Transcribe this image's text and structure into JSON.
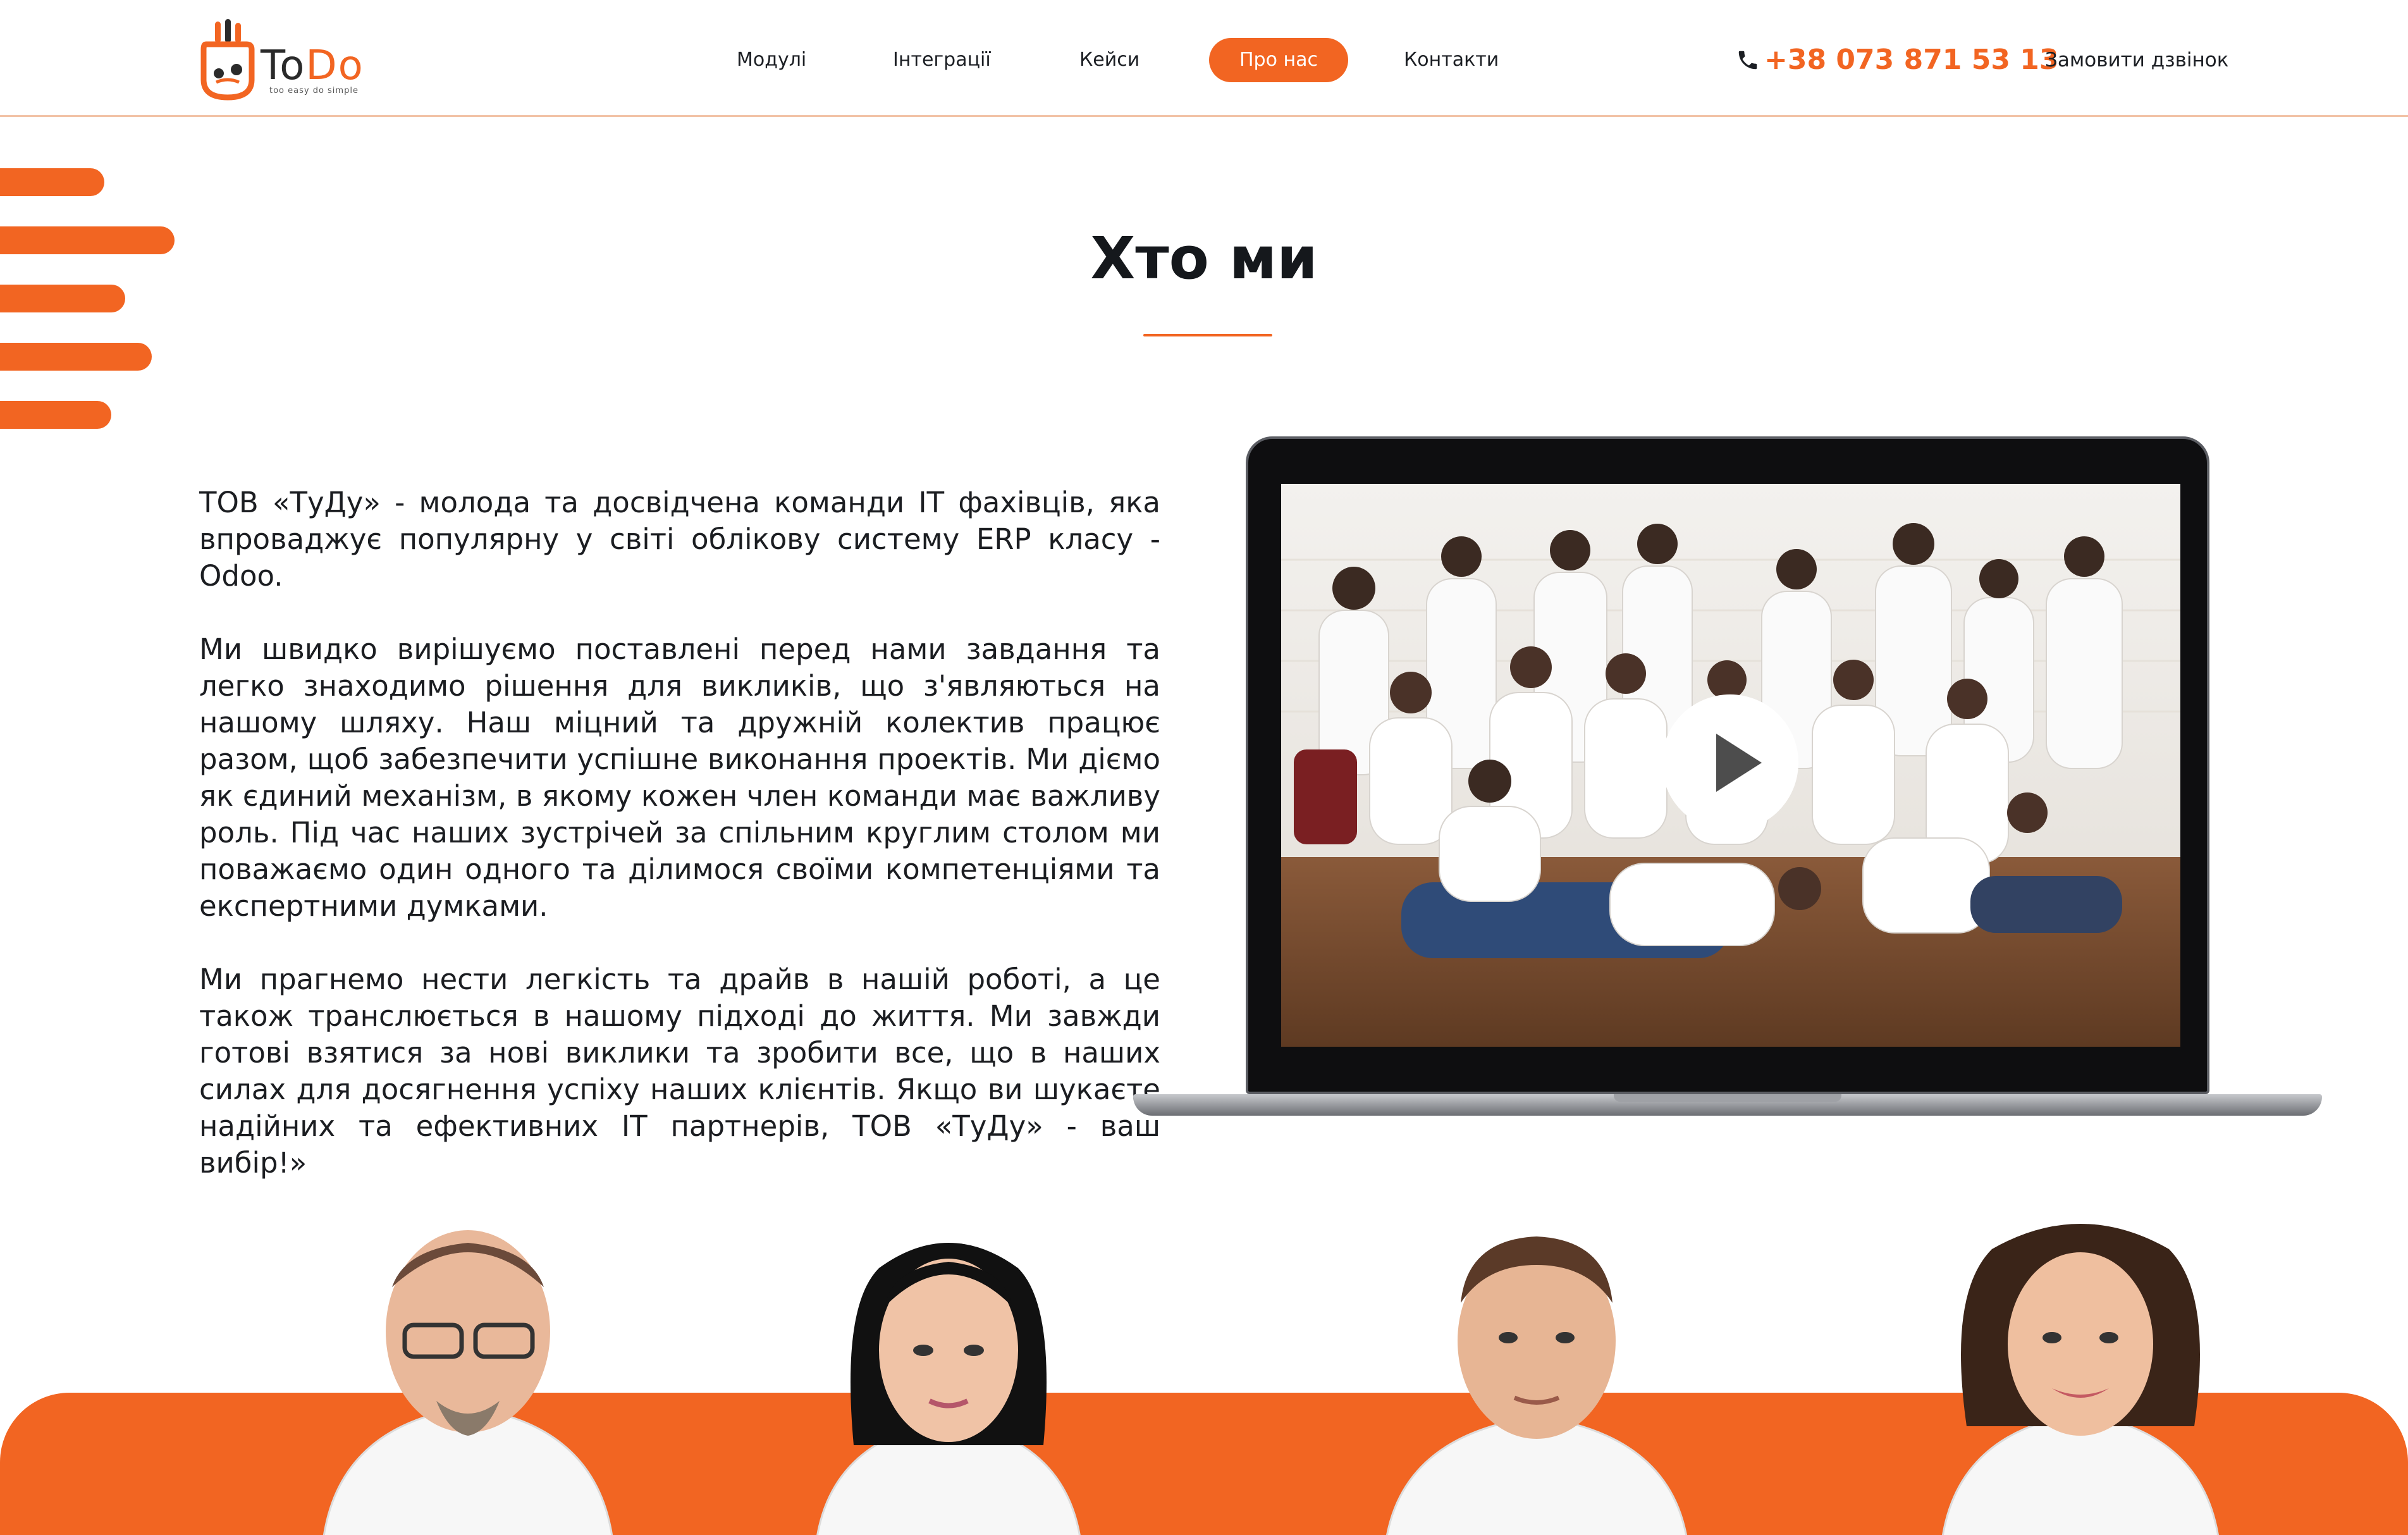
{
  "header": {
    "logo_text_to": "To",
    "logo_text_do": "Do",
    "logo_tagline": "too easy do simple",
    "nav": [
      {
        "label": "Модулі"
      },
      {
        "label": "Інтеграції"
      },
      {
        "label": "Кейси"
      },
      {
        "label": "Про нас",
        "active": true
      },
      {
        "label": "Контакти"
      }
    ],
    "phone": "+38 073 871 53 13",
    "callback_label": "Замовити дзвінок"
  },
  "main": {
    "title": "Хто ми",
    "paragraphs": [
      "ТОВ «ТуДу» - молода та досвідчена команди IT фахівців, яка впроваджує популярну у світі облікову систему ERP класу - Odoo.",
      "Ми швидко вирішуємо поставлені перед нами завдання та легко знаходимо рішення для викликів, що з'являються на нашому шляху. Наш міцний та дружній колектив працює разом, щоб забезпечити успішне виконання проектів. Ми діємо як єдиний механізм, в якому кожен член команди має важливу роль. Під час наших зустрічей за спільним круглим столом ми поважаємо один одного та ділимося своїми компетенціями та експертними думками.",
      "Ми прагнемо нести легкість та драйв в нашій роботі, а це також транслюється в нашому підході до життя. Ми завжди готові взятися за нові виклики та зробити все, що в наших силах для досягнення успіху наших клієнтів. Якщо ви шукаєте надійних та ефективних IT партнерів, ТОВ «ТуДу» - ваш вибір!»"
    ]
  },
  "colors": {
    "accent": "#f26522",
    "text": "#15181c"
  },
  "icons": {
    "phone": "phone-icon",
    "play": "play-icon"
  }
}
